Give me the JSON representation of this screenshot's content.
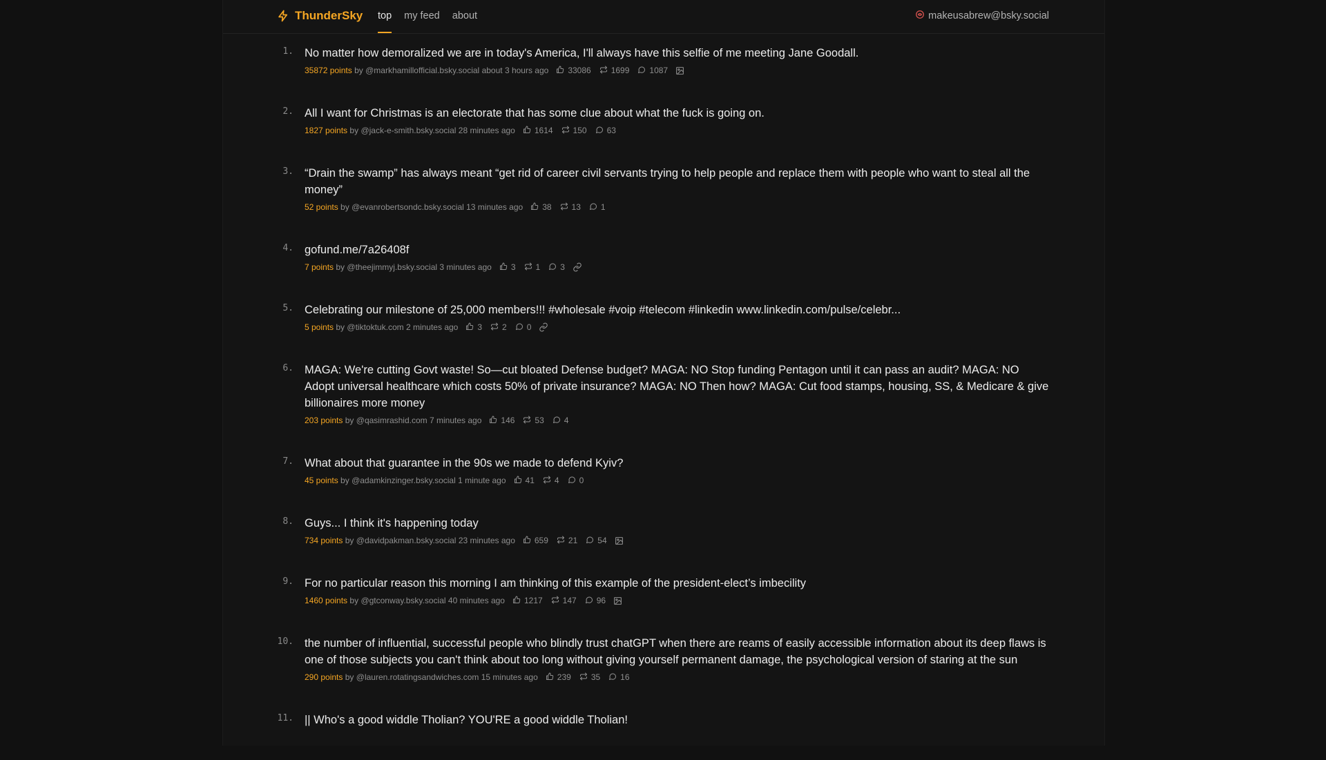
{
  "app": {
    "name": "ThunderSky",
    "accent_color": "#f5a623",
    "logo_icon": "bolt-icon"
  },
  "nav": {
    "tabs": [
      {
        "label": "top",
        "active": true
      },
      {
        "label": "my feed",
        "active": false
      },
      {
        "label": "about",
        "active": false
      }
    ]
  },
  "user": {
    "handle": "makeusabrew@bsky.social",
    "icon": "bluesky-account-icon"
  },
  "posts": [
    {
      "rank": "1.",
      "title": "No matter how demoralized we are in today's America, I'll always have this selfie of me meeting Jane Goodall.",
      "points": "35872 points",
      "by": "by",
      "handle": "@markhamillofficial.bsky.social",
      "age": "about 3 hours ago",
      "likes": "33086",
      "reposts": "1699",
      "replies": "1087",
      "media": "image-icon"
    },
    {
      "rank": "2.",
      "title": "All I want for Christmas is an electorate that has some clue about what the fuck is going on.",
      "points": "1827 points",
      "by": "by",
      "handle": "@jack-e-smith.bsky.social",
      "age": "28 minutes ago",
      "likes": "1614",
      "reposts": "150",
      "replies": "63",
      "media": ""
    },
    {
      "rank": "3.",
      "title": "“Drain the swamp” has always meant “get rid of career civil servants trying to help people and replace them with people who want to steal all the money”",
      "points": "52 points",
      "by": "by",
      "handle": "@evanrobertsondc.bsky.social",
      "age": "13 minutes ago",
      "likes": "38",
      "reposts": "13",
      "replies": "1",
      "media": ""
    },
    {
      "rank": "4.",
      "title": "gofund.me/7a26408f",
      "points": "7 points",
      "by": "by",
      "handle": "@theejimmyj.bsky.social",
      "age": "3 minutes ago",
      "likes": "3",
      "reposts": "1",
      "replies": "3",
      "media": "link-icon"
    },
    {
      "rank": "5.",
      "title": "Celebrating our milestone of 25,000 members!!! #wholesale #voip #telecom #linkedin www.linkedin.com/pulse/celebr...",
      "points": "5 points",
      "by": "by",
      "handle": "@tiktoktuk.com",
      "age": "2 minutes ago",
      "likes": "3",
      "reposts": "2",
      "replies": "0",
      "media": "link-icon"
    },
    {
      "rank": "6.",
      "title": "MAGA: We're cutting Govt waste! So—cut bloated Defense budget? MAGA: NO Stop funding Pentagon until it can pass an audit? MAGA: NO Adopt universal healthcare which costs 50% of private insurance? MAGA: NO Then how? MAGA: Cut food stamps, housing, SS, & Medicare & give billionaires more money",
      "points": "203 points",
      "by": "by",
      "handle": "@qasimrashid.com",
      "age": "7 minutes ago",
      "likes": "146",
      "reposts": "53",
      "replies": "4",
      "media": ""
    },
    {
      "rank": "7.",
      "title": "What about that guarantee in the 90s we made to defend Kyiv?",
      "points": "45 points",
      "by": "by",
      "handle": "@adamkinzinger.bsky.social",
      "age": "1 minute ago",
      "likes": "41",
      "reposts": "4",
      "replies": "0",
      "media": ""
    },
    {
      "rank": "8.",
      "title": "Guys... I think it's happening today",
      "points": "734 points",
      "by": "by",
      "handle": "@davidpakman.bsky.social",
      "age": "23 minutes ago",
      "likes": "659",
      "reposts": "21",
      "replies": "54",
      "media": "image-icon"
    },
    {
      "rank": "9.",
      "title": "For no particular reason this morning I am thinking of this example of the president-elect’s imbecility",
      "points": "1460 points",
      "by": "by",
      "handle": "@gtconway.bsky.social",
      "age": "40 minutes ago",
      "likes": "1217",
      "reposts": "147",
      "replies": "96",
      "media": "image-icon"
    },
    {
      "rank": "10.",
      "title": "the number of influential, successful people who blindly trust chatGPT when there are reams of easily accessible information about its deep flaws is one of those subjects you can't think about too long without giving yourself permanent damage, the psychological version of staring at the sun",
      "points": "290 points",
      "by": "by",
      "handle": "@lauren.rotatingsandwiches.com",
      "age": "15 minutes ago",
      "likes": "239",
      "reposts": "35",
      "replies": "16",
      "media": ""
    },
    {
      "rank": "11.",
      "title": "|| Who's a good widdle Tholian? YOU'RE a good widdle Tholian!",
      "points": "",
      "by": "",
      "handle": "",
      "age": "",
      "likes": "",
      "reposts": "",
      "replies": "",
      "media": ""
    }
  ]
}
